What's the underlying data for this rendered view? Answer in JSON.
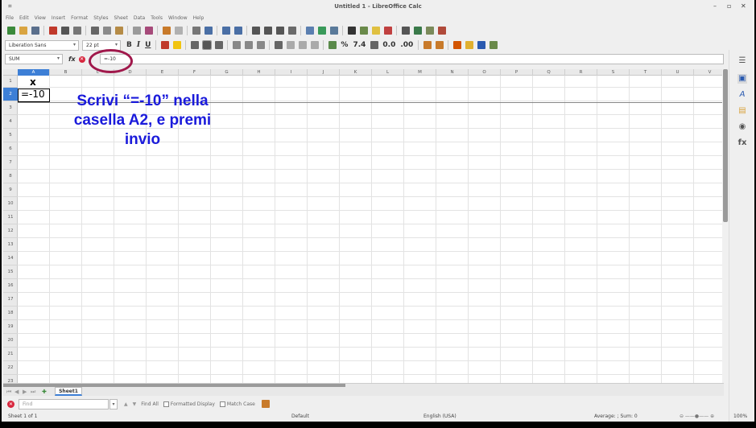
{
  "window": {
    "title": "Untitled 1 - LibreOffice Calc",
    "controls": {
      "minimize": "–",
      "maximize": "▫",
      "close": "✕"
    }
  },
  "menubar": {
    "items": [
      "File",
      "Edit",
      "View",
      "Insert",
      "Format",
      "Styles",
      "Sheet",
      "Data",
      "Tools",
      "Window",
      "Help"
    ]
  },
  "toolbar2": {
    "font_name": "Liberation Sans",
    "font_size": "22 pt",
    "bold": "B",
    "italic": "I",
    "underline": "U",
    "percent": "%",
    "decimal": "7.4",
    "add_decimal": "0.0",
    "del_decimal": ".00"
  },
  "formula_bar": {
    "name_box": "SUM",
    "fx": "fx",
    "cancel": "✕",
    "accept": "✓",
    "content": "=-10"
  },
  "columns": [
    "A",
    "B",
    "C",
    "D",
    "E",
    "F",
    "G",
    "H",
    "I",
    "J",
    "K",
    "L",
    "M",
    "N",
    "O",
    "P",
    "Q",
    "R",
    "S",
    "T",
    "U",
    "V"
  ],
  "rows": [
    "1",
    "2",
    "3",
    "4",
    "5",
    "6",
    "7",
    "8",
    "9",
    "10",
    "11",
    "12",
    "13",
    "14",
    "15",
    "16",
    "17",
    "18",
    "19",
    "20",
    "21",
    "22",
    "23"
  ],
  "cells": {
    "A1": "x",
    "A2": "=-10"
  },
  "annotation": "Scrivi “=-10” nella casella A2, e premi invio",
  "sheet_tab": "Sheet1",
  "findbar": {
    "placeholder": "Find",
    "find_all": "Find All",
    "formatted_display": "Formatted Display",
    "match_case": "Match Case"
  },
  "status": {
    "sheet": "Sheet 1 of 1",
    "style": "Default",
    "language": "English (USA)",
    "sum": "Average: ; Sum: 0",
    "zoom": "100%"
  },
  "colors": {
    "accent": "#3d7fd6",
    "annotation": "#1a1adb",
    "highlight_circle": "#a0184b"
  }
}
